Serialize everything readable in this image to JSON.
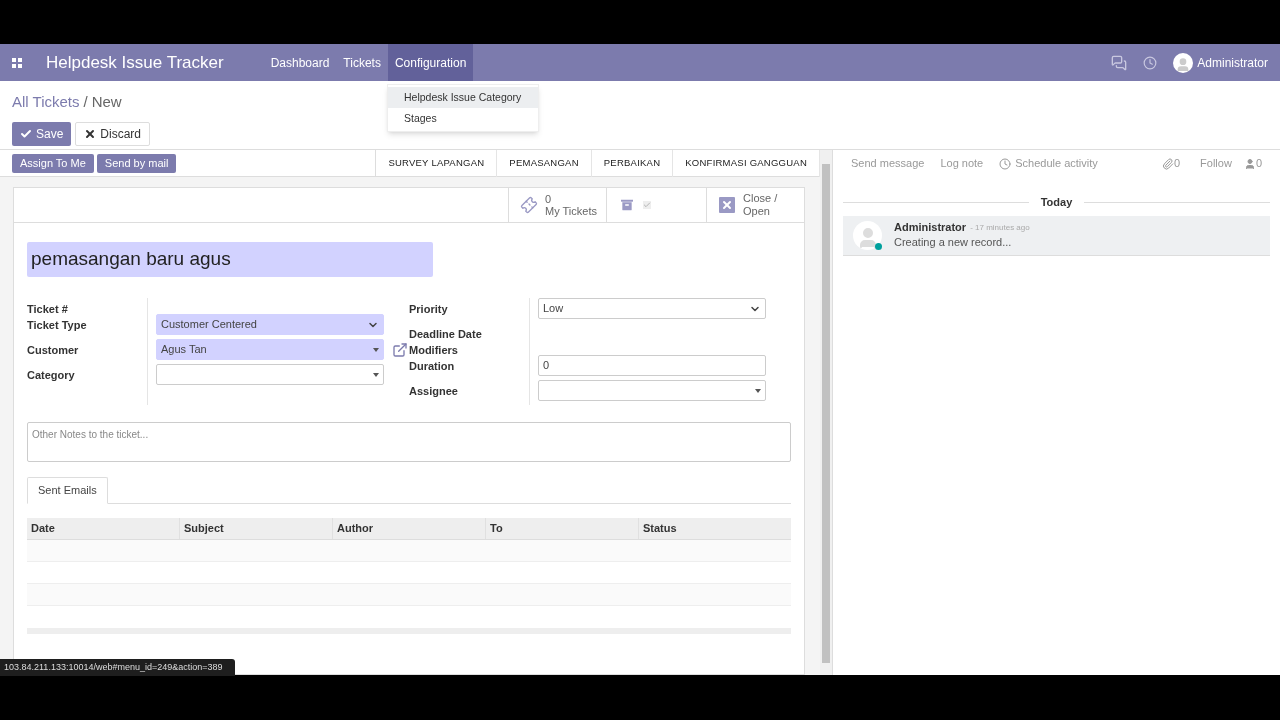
{
  "navbar": {
    "app_title": "Helpdesk Issue Tracker",
    "menus": [
      {
        "label": "Dashboard",
        "selected": false
      },
      {
        "label": "Tickets",
        "selected": false
      },
      {
        "label": "Configuration",
        "selected": true
      }
    ],
    "user_name": "Administrator"
  },
  "dropdown": {
    "items": [
      {
        "label": "Helpdesk Issue Category",
        "selected": true
      },
      {
        "label": "Stages",
        "selected": false
      }
    ]
  },
  "breadcrumb": {
    "parent": "All Tickets",
    "separator": "/",
    "current": "New"
  },
  "form_buttons": {
    "save": "Save",
    "discard": "Discard"
  },
  "header_buttons": [
    "Assign To Me",
    "Send by mail"
  ],
  "stages": [
    "SURVEY LAPANGAN",
    "PEMASANGAN",
    "PERBAIKAN",
    "KONFIRMASI GANGGUAN"
  ],
  "smart_buttons": [
    {
      "kind": "count",
      "value": "0",
      "label": "My Tickets"
    },
    {
      "kind": "archive",
      "active": true
    },
    {
      "kind": "close",
      "label": "Close / Open"
    }
  ],
  "title": "pemasangan baru agus",
  "left_fields": [
    {
      "label": "Ticket #",
      "kind": "none"
    },
    {
      "label": "Ticket Type",
      "kind": "select",
      "value": "Customer Centered",
      "required": true
    },
    {
      "label": "Customer",
      "kind": "many2one",
      "value": "Agus Tan",
      "required": true,
      "external_link": true
    },
    {
      "label": "Category",
      "kind": "many2one",
      "required": false
    }
  ],
  "right_fields": [
    {
      "label": "Priority",
      "kind": "select",
      "value": "Low",
      "required": false
    },
    {
      "label": "Deadline Date",
      "kind": "none"
    },
    {
      "label": "Modifiers",
      "kind": "none"
    },
    {
      "label": "Duration",
      "kind": "input",
      "value": "0",
      "required": false
    },
    {
      "label": "Assignee",
      "kind": "many2one",
      "required": false
    }
  ],
  "notes": {
    "placeholder": "Other Notes to the ticket..."
  },
  "tabs": [
    {
      "label": "Sent Emails",
      "selected": true
    }
  ],
  "table": {
    "columns": [
      "Date",
      "Subject",
      "Author",
      "To",
      "Status"
    ]
  },
  "chatter": {
    "actions": [
      "Send message",
      "Log note",
      "Schedule activity"
    ],
    "attachments": "0",
    "follow": "Follow",
    "followers": "0",
    "date_separator": "Today",
    "messages": [
      {
        "author": "Administrator",
        "time": "- 17 minutes ago",
        "body": "Creating a new record...",
        "online": true
      }
    ]
  },
  "status_url": "103.84.211.133:10014/web#menu_id=249&action=389"
}
